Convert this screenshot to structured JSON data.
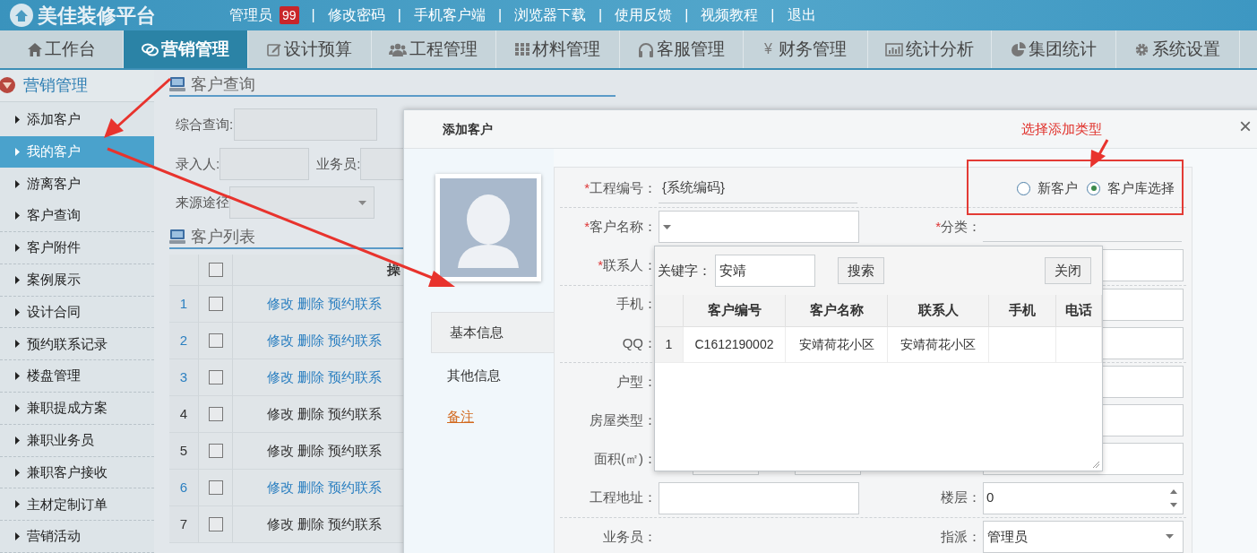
{
  "header": {
    "logo_text": "美佳装修平台",
    "items": [
      {
        "kind": "user",
        "text": "管理员",
        "badge": "99"
      },
      {
        "kind": "separator",
        "text": "|"
      },
      {
        "kind": "link",
        "text": "修改密码"
      },
      {
        "kind": "separator",
        "text": "|"
      },
      {
        "kind": "link",
        "text": "手机客户端"
      },
      {
        "kind": "separator",
        "text": "|"
      },
      {
        "kind": "link",
        "text": "浏览器下载"
      },
      {
        "kind": "separator",
        "text": "|"
      },
      {
        "kind": "link",
        "text": "使用反馈"
      },
      {
        "kind": "separator",
        "text": "|"
      },
      {
        "kind": "link",
        "text": "视频教程"
      },
      {
        "kind": "separator",
        "text": "|"
      },
      {
        "kind": "link",
        "text": "退出"
      }
    ]
  },
  "nav_tabs": [
    {
      "label": "工作台",
      "selected": false
    },
    {
      "label": "营销管理",
      "selected": true
    },
    {
      "label": "设计预算",
      "selected": false
    },
    {
      "label": "工程管理",
      "selected": false
    },
    {
      "label": "材料管理",
      "selected": false
    },
    {
      "label": "客服管理",
      "selected": false
    },
    {
      "label": "财务管理",
      "selected": false,
      "icon_text": "¥"
    },
    {
      "label": "统计分析",
      "selected": false
    },
    {
      "label": "集团统计",
      "selected": false
    },
    {
      "label": "系统设置",
      "selected": false
    }
  ],
  "sidebar": {
    "title": "营销管理",
    "expanded": true,
    "items": [
      {
        "label": "添加客户",
        "selected": false
      },
      {
        "label": "我的客户",
        "selected": true
      },
      {
        "label": "游离客户",
        "selected": false
      },
      {
        "label": "客户查询",
        "selected": false
      },
      {
        "label": "客户附件",
        "selected": false
      },
      {
        "label": "案例展示",
        "selected": false
      },
      {
        "label": "设计合同",
        "selected": false
      },
      {
        "label": "预约联系记录",
        "selected": false
      },
      {
        "label": "楼盘管理",
        "selected": false
      },
      {
        "label": "兼职提成方案",
        "selected": false
      },
      {
        "label": "兼职业务员",
        "selected": false
      },
      {
        "label": "兼职客户接收",
        "selected": false
      },
      {
        "label": "主材定制订单",
        "selected": false
      },
      {
        "label": "营销活动",
        "selected": false
      }
    ]
  },
  "query_panel": {
    "title": "客户查询",
    "general_label": "综合查询:",
    "entered_by_label": "录入人:",
    "salesman_label": "业务员:",
    "source_label": "来源途径"
  },
  "list_panel": {
    "title": "客户列表",
    "header_checked": false,
    "action_header": "操",
    "rows": [
      {
        "number": "1",
        "actions": "修改 删除 预约联系",
        "highlighted": true,
        "checked": false
      },
      {
        "number": "2",
        "actions": "修改 删除 预约联系",
        "highlighted": true,
        "checked": false
      },
      {
        "number": "3",
        "actions": "修改 删除 预约联系",
        "highlighted": true,
        "checked": false
      },
      {
        "number": "4",
        "actions": "修改 删除 预约联系",
        "highlighted": false,
        "checked": false
      },
      {
        "number": "5",
        "actions": "修改 删除 预约联系",
        "highlighted": false,
        "checked": false
      },
      {
        "number": "6",
        "actions": "修改 删除 预约联系",
        "highlighted": true,
        "checked": false
      },
      {
        "number": "7",
        "actions": "修改 删除 预约联系",
        "highlighted": false,
        "checked": false
      }
    ]
  },
  "dialog": {
    "title": "添加客户",
    "close": "×",
    "required_mark": "*",
    "side_tabs": [
      {
        "label": "基本信息",
        "selected": true,
        "kind": "tab"
      },
      {
        "label": "其他信息",
        "selected": false,
        "kind": "tab"
      },
      {
        "label": "备注",
        "selected": false,
        "kind": "link"
      }
    ],
    "form_rows": [
      {
        "divider_after": true,
        "left": {
          "label": "工程编号：",
          "required": true,
          "kind": "underline",
          "value": "{系统编码}"
        },
        "right": {
          "kind": "radios",
          "options": [
            {
              "label": "新客户",
              "selected": false
            },
            {
              "label": "客户库选择",
              "selected": true
            }
          ]
        }
      },
      {
        "left": {
          "label": "客户名称：",
          "required": true,
          "kind": "select"
        },
        "right": {
          "label": "分类：",
          "required": true,
          "kind": "underline"
        }
      },
      {
        "divider_after": true,
        "left": {
          "label": "联系人：",
          "required": true,
          "kind": "hidden"
        },
        "right": {
          "kind": "select"
        }
      },
      {
        "left": {
          "label": "手机：",
          "required": false,
          "kind": "hidden"
        },
        "right": {
          "kind": "text"
        }
      },
      {
        "divider_after": true,
        "left": {
          "label": "QQ：",
          "required": false,
          "kind": "hidden"
        },
        "right": {
          "kind": "text"
        }
      },
      {
        "left": {
          "label": "户型：",
          "required": false,
          "kind": "hidden"
        },
        "right": {
          "kind": "select"
        }
      },
      {
        "left": {
          "label": "房屋类型：",
          "required": false,
          "kind": "hidden"
        },
        "right": {
          "kind": "select"
        }
      },
      {
        "left": {
          "label": "面积(㎡)：",
          "required": false,
          "kind": "pair"
        },
        "right": {
          "kind": "text"
        }
      },
      {
        "divider_after": true,
        "left": {
          "label": "工程地址：",
          "required": false,
          "kind": "text"
        },
        "right": {
          "label": "楼层：",
          "required": false,
          "kind": "number",
          "value": "0"
        }
      },
      {
        "left": {
          "label": "业务员：",
          "required": false,
          "kind": "plain"
        },
        "right": {
          "label": "指派：",
          "required": false,
          "kind": "select",
          "value": "管理员"
        }
      }
    ],
    "customer_picker": {
      "keyword_label": "关键字：",
      "keyword_value": "安靖",
      "search_button": "搜索",
      "close_button": "关闭",
      "columns": [
        "客户编号",
        "客户名称",
        "联系人",
        "手机",
        "电话"
      ],
      "rows": [
        {
          "number": "1",
          "code": "C1612190002",
          "name": "安靖荷花小区",
          "contact": "安靖荷花小区"
        }
      ]
    }
  },
  "annotation": {
    "note": "选择添加类型"
  }
}
